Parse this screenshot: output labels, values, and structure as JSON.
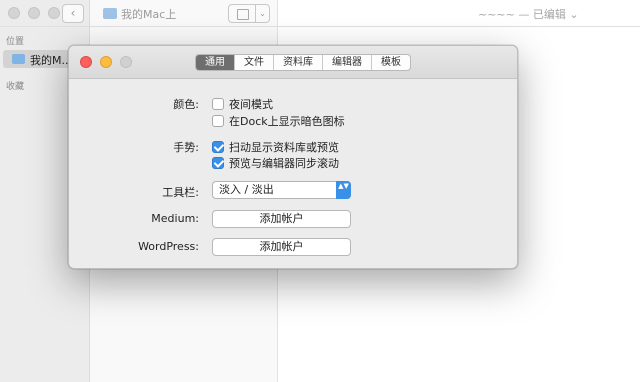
{
  "background_app": {
    "folder_title": "我的Mac上",
    "doc_title": "~~~~ — 已编辑 ⌄",
    "back_glyph": "‹",
    "layout_chevron": "⌄",
    "sidebar": {
      "section_location": "位置",
      "location_item": "我的M...",
      "section_favorites": "收藏"
    }
  },
  "preferences": {
    "tabs": [
      {
        "label": "通用",
        "active": true
      },
      {
        "label": "文件",
        "active": false
      },
      {
        "label": "资料库",
        "active": false
      },
      {
        "label": "编辑器",
        "active": false
      },
      {
        "label": "模板",
        "active": false
      }
    ],
    "color": {
      "label": "颜色:",
      "options": [
        {
          "label": "夜间模式",
          "checked": false
        },
        {
          "label": "在Dock上显示暗色图标",
          "checked": false
        }
      ]
    },
    "gestures": {
      "label": "手势:",
      "options": [
        {
          "label": "扫动显示资料库或预览",
          "checked": true
        },
        {
          "label": "预览与编辑器同步滚动",
          "checked": true
        }
      ]
    },
    "toolbar": {
      "label": "工具栏:",
      "selected_value": "淡入 / 淡出",
      "stepper_glyph": "▲▼"
    },
    "medium": {
      "label": "Medium:",
      "button_label": "添加帐户"
    },
    "wordpress": {
      "label": "WordPress:",
      "button_label": "添加帐户"
    }
  },
  "colors": {
    "accent": "#3a8fe6",
    "close": "#fc615d",
    "minimize": "#fdbc40",
    "active_tab": "#6e6e6e"
  }
}
